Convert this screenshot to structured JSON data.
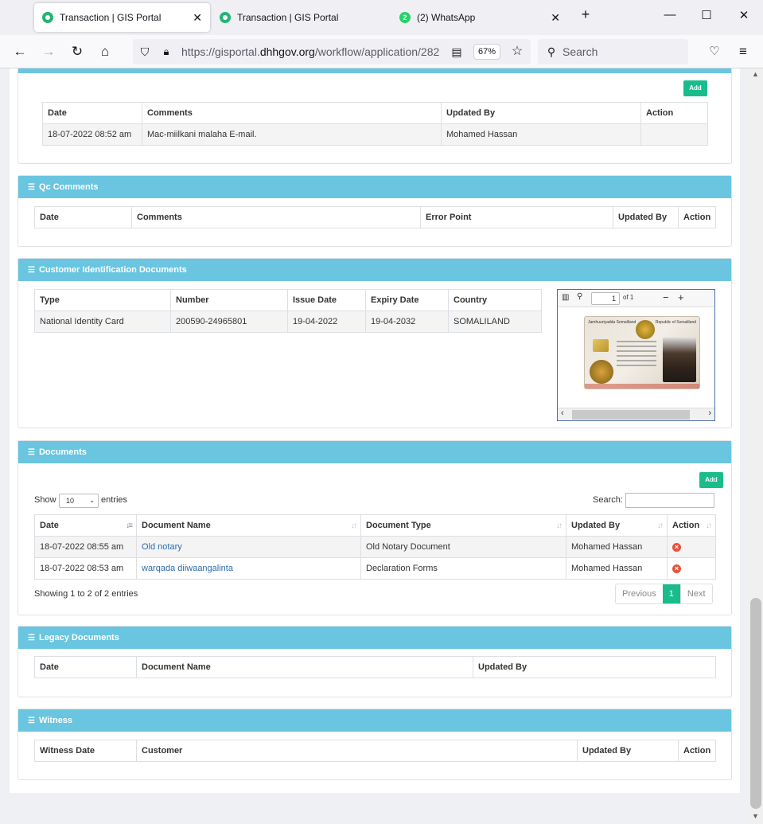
{
  "browser": {
    "tabs": [
      {
        "title": "Transaction | GIS Portal",
        "active": true,
        "icon": "gis-portal-icon"
      },
      {
        "title": "Transaction | GIS Portal",
        "active": false,
        "icon": "gis-portal-icon"
      },
      {
        "title": "(2) WhatsApp",
        "active": false,
        "icon": "whatsapp-icon",
        "badge": "2"
      }
    ],
    "url_prefix": "https://gisportal.",
    "url_domain": "dhhgov.org",
    "url_path": "/workflow/application/282",
    "zoom": "67%",
    "search_placeholder": "Search"
  },
  "colors": {
    "header_bg": "#69c5e0",
    "accent_green": "#1abc8c",
    "link": "#2a6bb0",
    "danger": "#e8533a"
  },
  "top_comments": {
    "add_label": "Add",
    "columns": [
      "Date",
      "Comments",
      "Updated By",
      "Action"
    ],
    "rows": [
      {
        "date": "18-07-2022 08:52 am",
        "comment": "Mac-miilkani malaha E-mail.",
        "updated_by": "Mohamed Hassan",
        "action": ""
      }
    ]
  },
  "qc_comments": {
    "title": "Qc Comments",
    "columns": [
      "Date",
      "Comments",
      "Error Point",
      "Updated By",
      "Action"
    ]
  },
  "customer_id_docs": {
    "title": "Customer Identification Documents",
    "columns": [
      "Type",
      "Number",
      "Issue Date",
      "Expiry Date",
      "Country"
    ],
    "rows": [
      {
        "type": "National Identity Card",
        "number": "200590-24965801",
        "issue_date": "19-04-2022",
        "expiry_date": "19-04-2032",
        "country": "SOMALILAND"
      }
    ],
    "viewer": {
      "page": "1",
      "of_label": "of 1"
    }
  },
  "documents": {
    "title": "Documents",
    "add_label": "Add",
    "show_label": "Show",
    "entries_value": "10",
    "entries_label": "entries",
    "search_label": "Search:",
    "columns": [
      "Date",
      "Document Name",
      "Document Type",
      "Updated By",
      "Action"
    ],
    "rows": [
      {
        "date": "18-07-2022 08:55 am",
        "name": "Old notary",
        "type": "Old Notary Document",
        "updated_by": "Mohamed Hassan"
      },
      {
        "date": "18-07-2022 08:53 am",
        "name": "warqada diiwaangalinta",
        "type": "Declaration Forms",
        "updated_by": "Mohamed Hassan"
      }
    ],
    "info": "Showing 1 to 2 of 2 entries",
    "pager": {
      "previous": "Previous",
      "current": "1",
      "next": "Next"
    }
  },
  "legacy_docs": {
    "title": "Legacy Documents",
    "columns": [
      "Date",
      "Document Name",
      "Updated By"
    ]
  },
  "witness": {
    "title": "Witness",
    "columns": [
      "Witness Date",
      "Customer",
      "Updated By",
      "Action"
    ]
  }
}
